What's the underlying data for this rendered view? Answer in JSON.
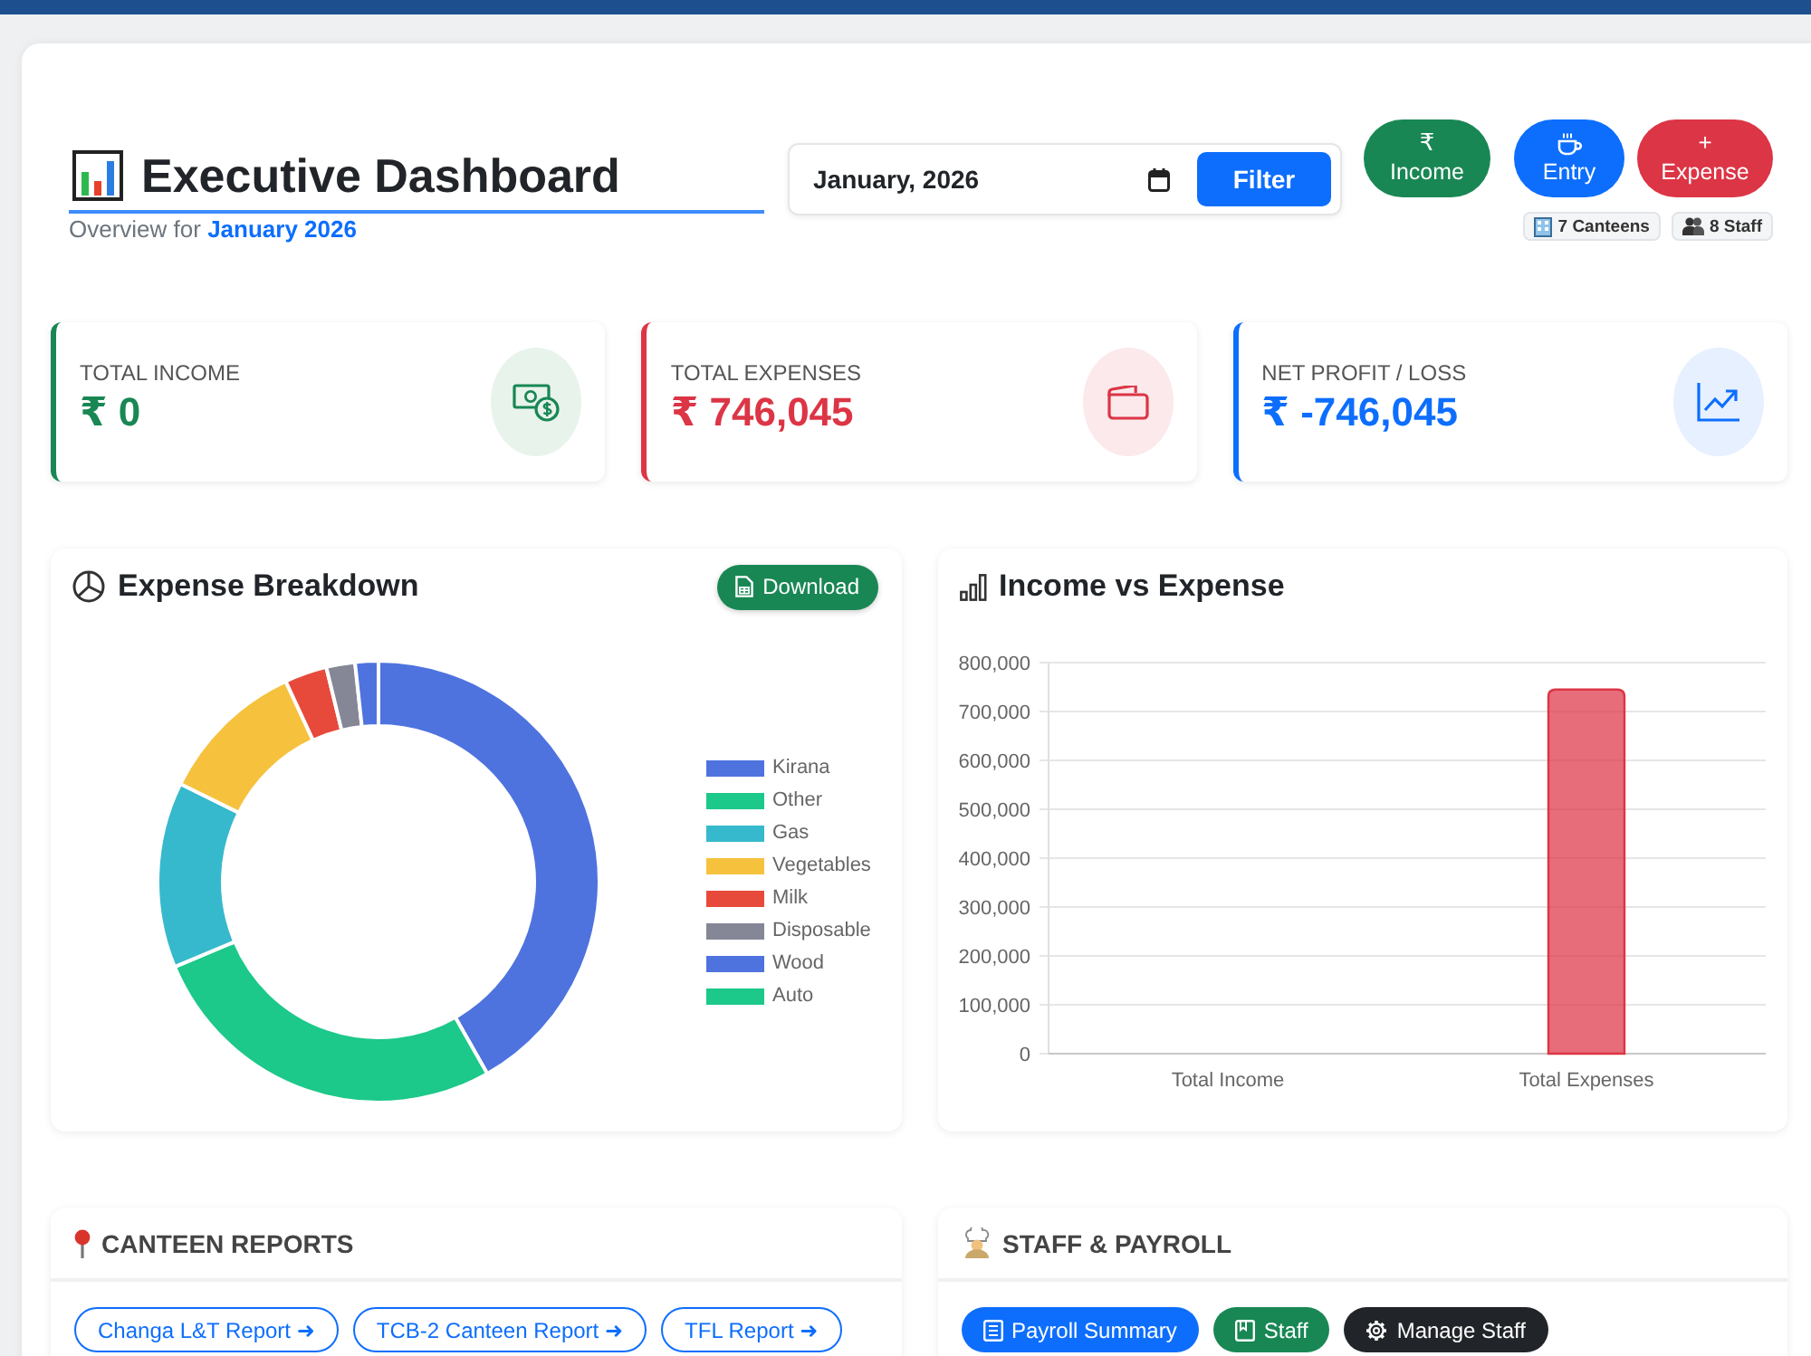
{
  "header": {
    "title": "Executive Dashboard",
    "subtitle": "Overview for **January 2026**"
  },
  "filter": {
    "month": "January, 2026",
    "button": "Filter"
  },
  "actions": [
    {
      "kind": "income",
      "symbol": "₹",
      "label": "Income"
    },
    {
      "kind": "entry",
      "label": "Entry"
    },
    {
      "kind": "expense",
      "symbol": "+",
      "label": "Expense"
    }
  ],
  "badges": [
    {
      "kind": "canteens",
      "label": "7 Canteens"
    },
    {
      "kind": "staff",
      "label": "8 Staff"
    }
  ],
  "stats": [
    {
      "kind": "income",
      "label": "TOTAL INCOME",
      "value": "₹ 0"
    },
    {
      "kind": "expense",
      "label": "TOTAL EXPENSES",
      "value": "₹ 746,045"
    },
    {
      "kind": "profit",
      "label": "NET PROFIT / LOSS",
      "value": "₹ -746,045"
    }
  ],
  "expense_breakdown": {
    "title": "Expense Breakdown",
    "button": "Download",
    "legend": [
      {
        "label": "Kirana",
        "color": "#4e73df"
      },
      {
        "label": "Other",
        "color": "#1cc88a"
      },
      {
        "label": "Gas",
        "color": "#36b9cc"
      },
      {
        "label": "Vegetables",
        "color": "#f6c23e"
      },
      {
        "label": "Milk",
        "color": "#e74a3b"
      },
      {
        "label": "Disposable",
        "color": "#858796"
      },
      {
        "label": "Wood",
        "color": "#4e73df"
      },
      {
        "label": "Auto",
        "color": "#1cc88a"
      }
    ]
  },
  "income_vs_expense": {
    "title": "Income vs Expense",
    "chart_data": {
      "type": "bar",
      "categories": [
        "Total Income",
        "Total Expenses"
      ],
      "series": [
        {
          "color": "#dc3545",
          "values": [
            0,
            745000
          ]
        }
      ],
      "ylim": [
        0,
        800000
      ],
      "grid": true,
      "yticks": [
        {
          "value": 0,
          "label": "0"
        },
        {
          "value": 100000,
          "label": "100,000"
        },
        {
          "value": 200000,
          "label": "200,000"
        },
        {
          "value": 300000,
          "label": "300,000"
        },
        {
          "value": 400000,
          "label": "400,000"
        },
        {
          "value": 500000,
          "label": "500,000"
        },
        {
          "value": 600000,
          "label": "600,000"
        },
        {
          "value": 700000,
          "label": "700,000"
        },
        {
          "value": 800000,
          "label": "800,000"
        }
      ]
    }
  },
  "canteen_reports": {
    "title": "CANTEEN REPORTS",
    "links": [
      "Changa L&T Report ➜",
      "TCB-2 Canteen Report ➜",
      "TFL Report ➜"
    ]
  },
  "staff_payroll": {
    "title": "STAFF & PAYROLL",
    "buttons": [
      {
        "kind": "payroll",
        "label": "Payroll Summary"
      },
      {
        "kind": "staff",
        "label": "Staff"
      },
      {
        "kind": "manage",
        "label": "Manage Staff"
      }
    ]
  }
}
